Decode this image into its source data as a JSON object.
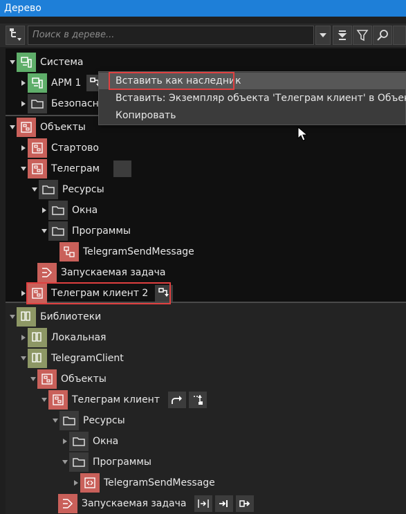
{
  "window": {
    "title": "Дерево"
  },
  "toolbar": {
    "search_placeholder": "Поиск в дереве..."
  },
  "tree": {
    "system": {
      "label": "Система",
      "arm": "АРМ 1",
      "security": "Безопасность"
    },
    "objects": {
      "label": "Объекты",
      "startup": "Стартово",
      "telegram": "Телеграм",
      "resources": "Ресурсы",
      "windows": "Окна",
      "programs": "Программы",
      "send_message": "TelegramSendMessage",
      "task": "Запускаемая задача",
      "telegram2": "Телеграм клиент 2"
    },
    "libraries": {
      "label": "Библиотеки",
      "local": "Локальная",
      "telegram_client": "TelegramClient",
      "objects": "Объекты",
      "telegram_client_obj": "Телеграм клиент",
      "resources": "Ресурсы",
      "windows": "Окна",
      "programs": "Программы",
      "send_message": "TelegramSendMessage",
      "task": "Запускаемая задача"
    }
  },
  "context_menu": {
    "items": [
      "Вставить как наследник",
      "Вставить: Экземпляр объекта 'Телеграм клиент' в Объекты",
      "Копировать"
    ]
  },
  "colors": {
    "title_bar": "#1e7fd8",
    "system_icon": "#5fae6a",
    "object_icon": "#c9605a",
    "library_icon": "#8d9765",
    "highlight": "#e04040"
  }
}
